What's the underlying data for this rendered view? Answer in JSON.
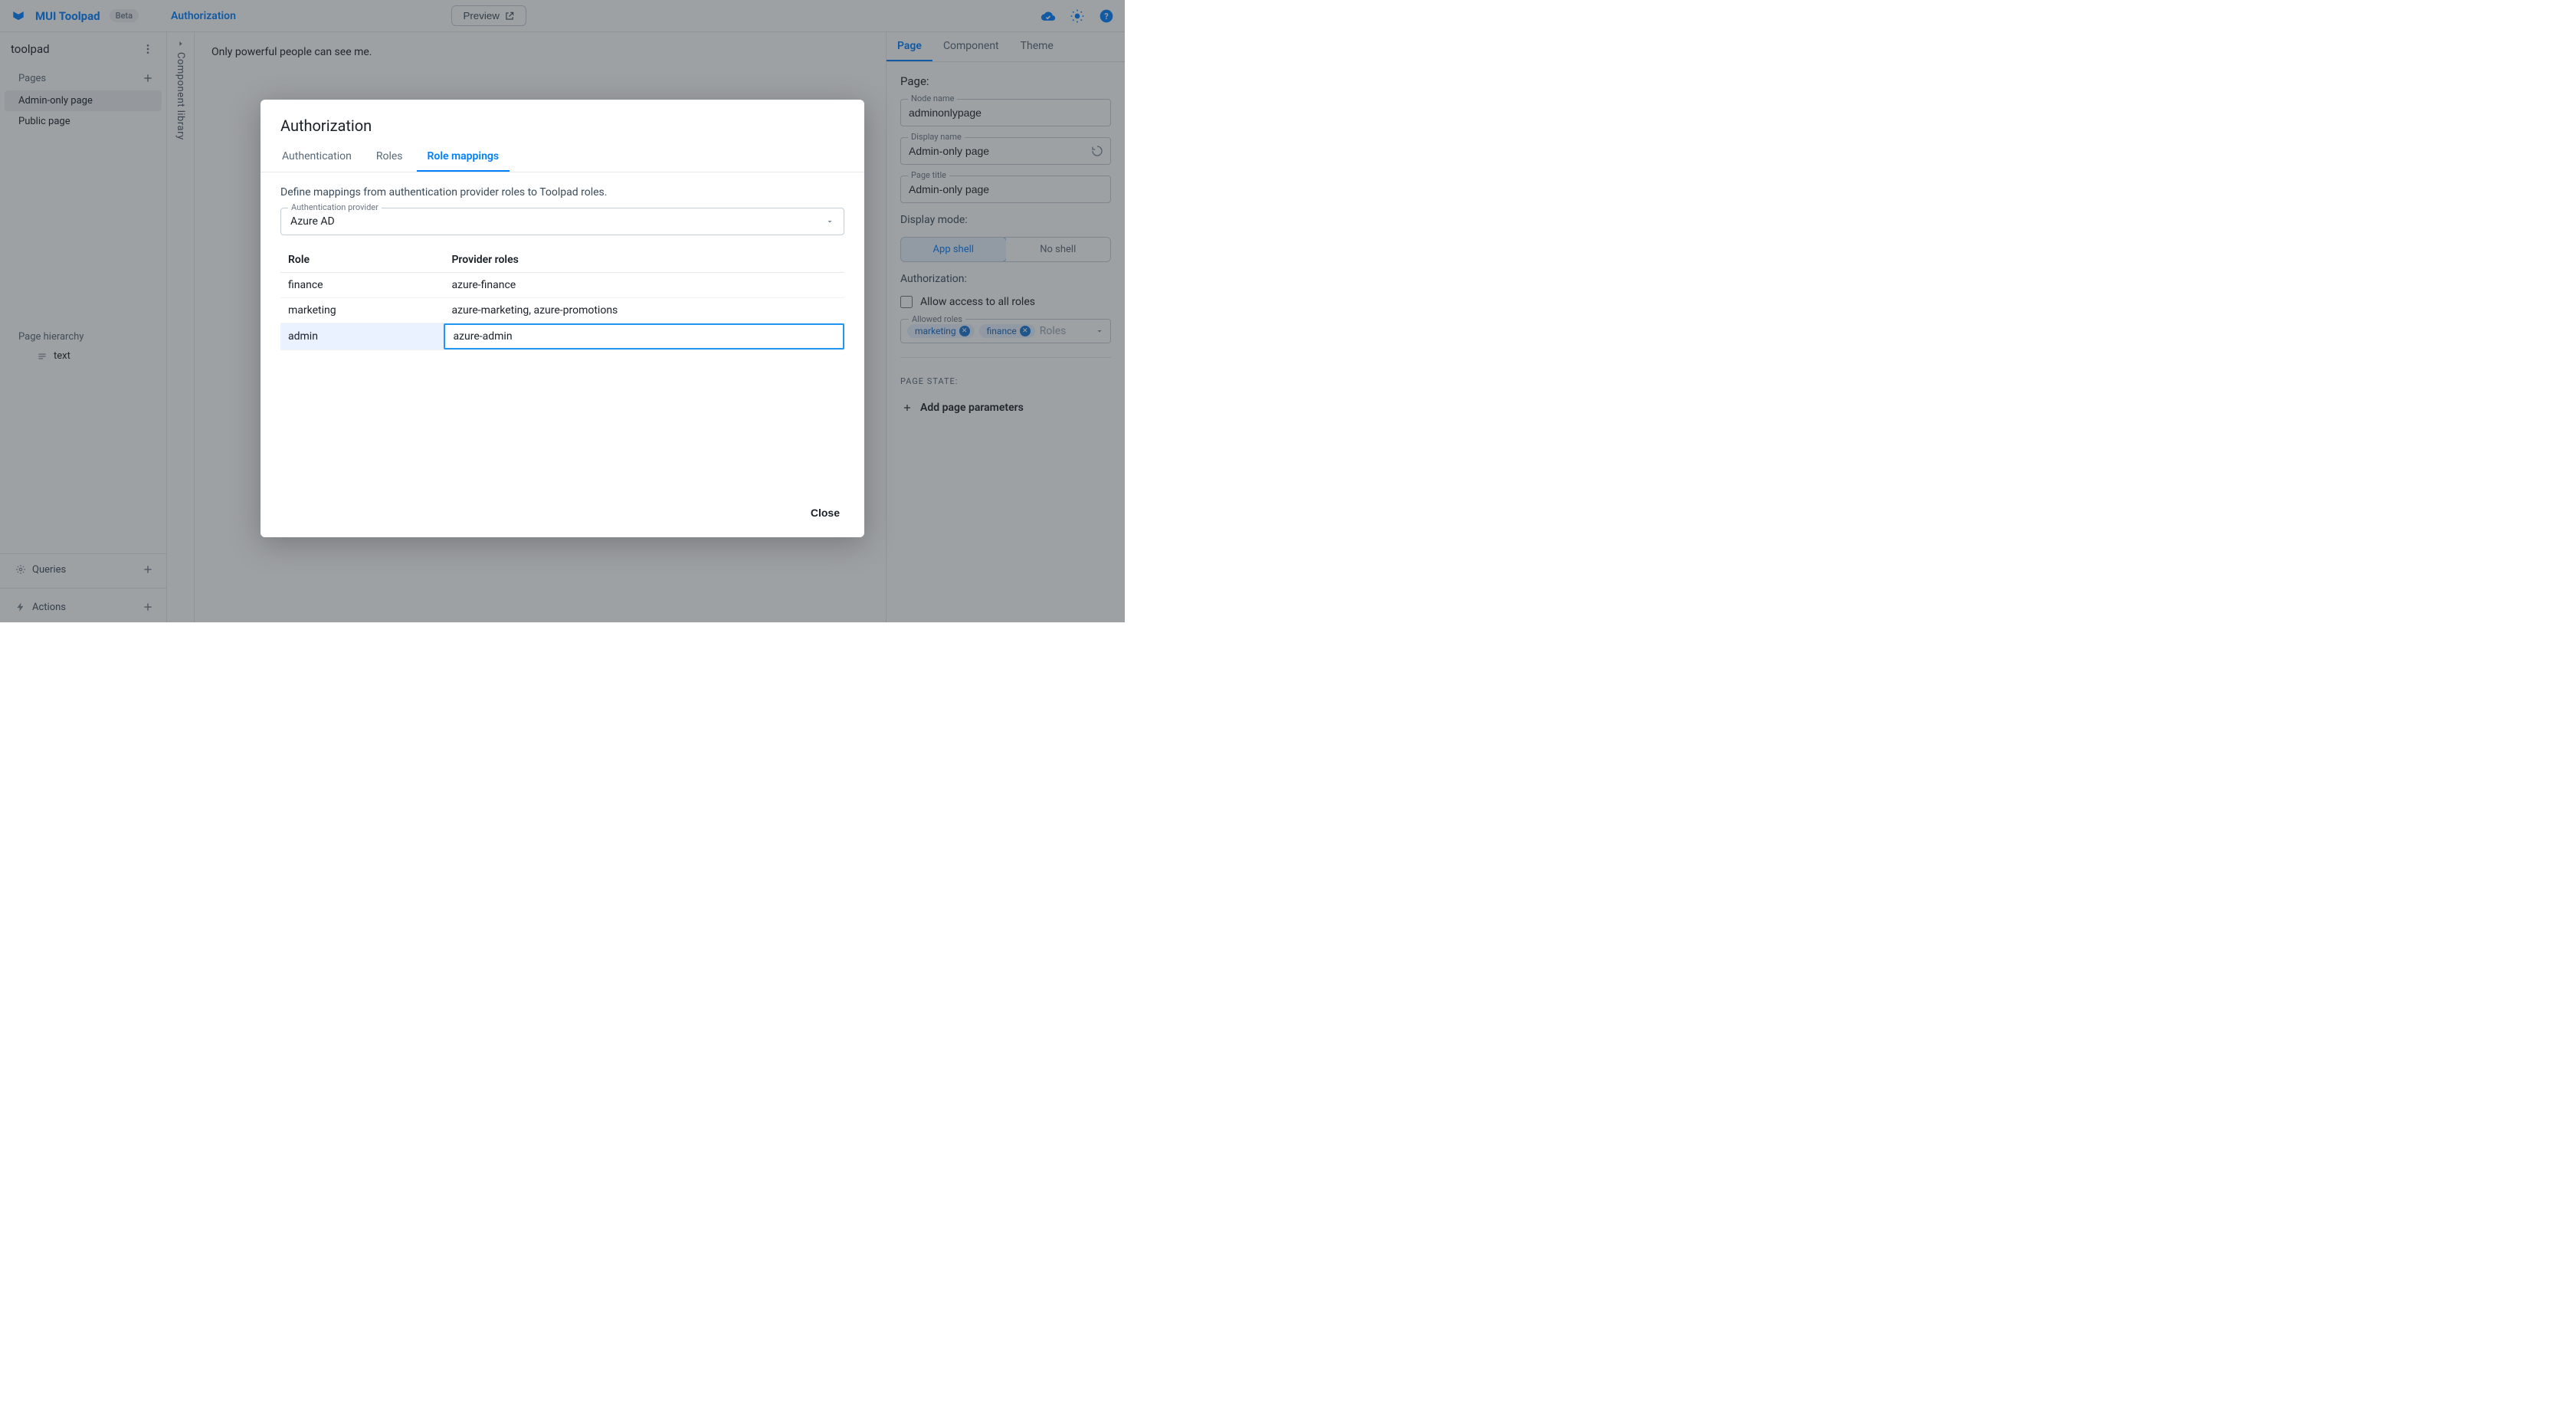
{
  "brand": "MUI Toolpad",
  "beta": "Beta",
  "topbar": {
    "link": "Authorization",
    "preview": "Preview"
  },
  "sidebar": {
    "app_name": "toolpad",
    "pages_header": "Pages",
    "pages": [
      {
        "label": "Admin-only page",
        "active": true
      },
      {
        "label": "Public page",
        "active": false
      }
    ],
    "hierarchy_header": "Page hierarchy",
    "tree": [
      {
        "label": "text"
      }
    ],
    "queries_header": "Queries",
    "actions_header": "Actions",
    "complib_label": "Component library"
  },
  "canvas": {
    "text": "Only powerful people can see me."
  },
  "inspector": {
    "tabs": [
      "Page",
      "Component",
      "Theme"
    ],
    "active_tab": "Page",
    "panel_title": "Page:",
    "node_name_label": "Node name",
    "node_name": "adminonlypage",
    "display_name_label": "Display name",
    "display_name": "Admin-only page",
    "page_title_label": "Page title",
    "page_title": "Admin-only page",
    "display_mode_label": "Display mode:",
    "display_mode_options": [
      "App shell",
      "No shell"
    ],
    "display_mode_selected": "App shell",
    "authorization_label": "Authorization:",
    "allow_all_label": "Allow access to all roles",
    "allow_all_checked": false,
    "allowed_roles_label": "Allowed roles",
    "allowed_roles": [
      "marketing",
      "finance"
    ],
    "roles_placeholder": "Roles",
    "page_state_label": "PAGE STATE:",
    "add_params_label": "Add page parameters"
  },
  "dialog": {
    "title": "Authorization",
    "tabs": [
      "Authentication",
      "Roles",
      "Role mappings"
    ],
    "active_tab": "Role mappings",
    "description": "Define mappings from authentication provider roles to Toolpad roles.",
    "provider_label": "Authentication provider",
    "provider_value": "Azure AD",
    "columns": {
      "role": "Role",
      "provider_roles": "Provider roles"
    },
    "rows": [
      {
        "role": "finance",
        "provider_roles": "azure-finance",
        "editing": false
      },
      {
        "role": "marketing",
        "provider_roles": "azure-marketing, azure-promotions",
        "editing": false
      },
      {
        "role": "admin",
        "provider_roles": "azure-admin",
        "editing": true
      }
    ],
    "close_label": "Close"
  }
}
